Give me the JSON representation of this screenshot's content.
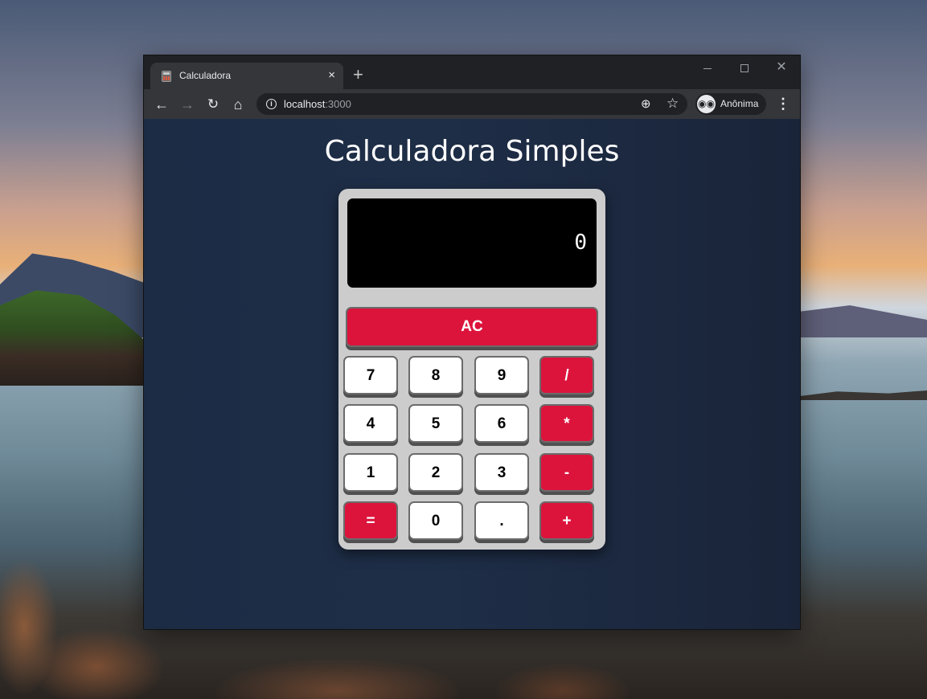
{
  "browser": {
    "tab": {
      "title": "Calculadora",
      "close_glyph": "×",
      "favicon": "calculator-favicon"
    },
    "new_tab_glyph": "+",
    "window_controls": {
      "close_glyph": "✕"
    },
    "nav": {
      "back_glyph": "←",
      "forward_glyph": "→",
      "reload_glyph": "↻",
      "home_glyph": "⌂"
    },
    "address": {
      "host": "localhost",
      "port": ":3000"
    },
    "profile_label": "Anônima",
    "menu_glyph": "⋮"
  },
  "page": {
    "title": "Calculadora Simples",
    "display_value": "0",
    "clear_label": "AC",
    "accent_color": "#dc143c",
    "keys": {
      "k7": "7",
      "k8": "8",
      "k9": "9",
      "div": "/",
      "k4": "4",
      "k5": "5",
      "k6": "6",
      "mul": "*",
      "k1": "1",
      "k2": "2",
      "k3": "3",
      "sub": "-",
      "eq": "=",
      "k0": "0",
      "dot": ".",
      "add": "+"
    }
  }
}
